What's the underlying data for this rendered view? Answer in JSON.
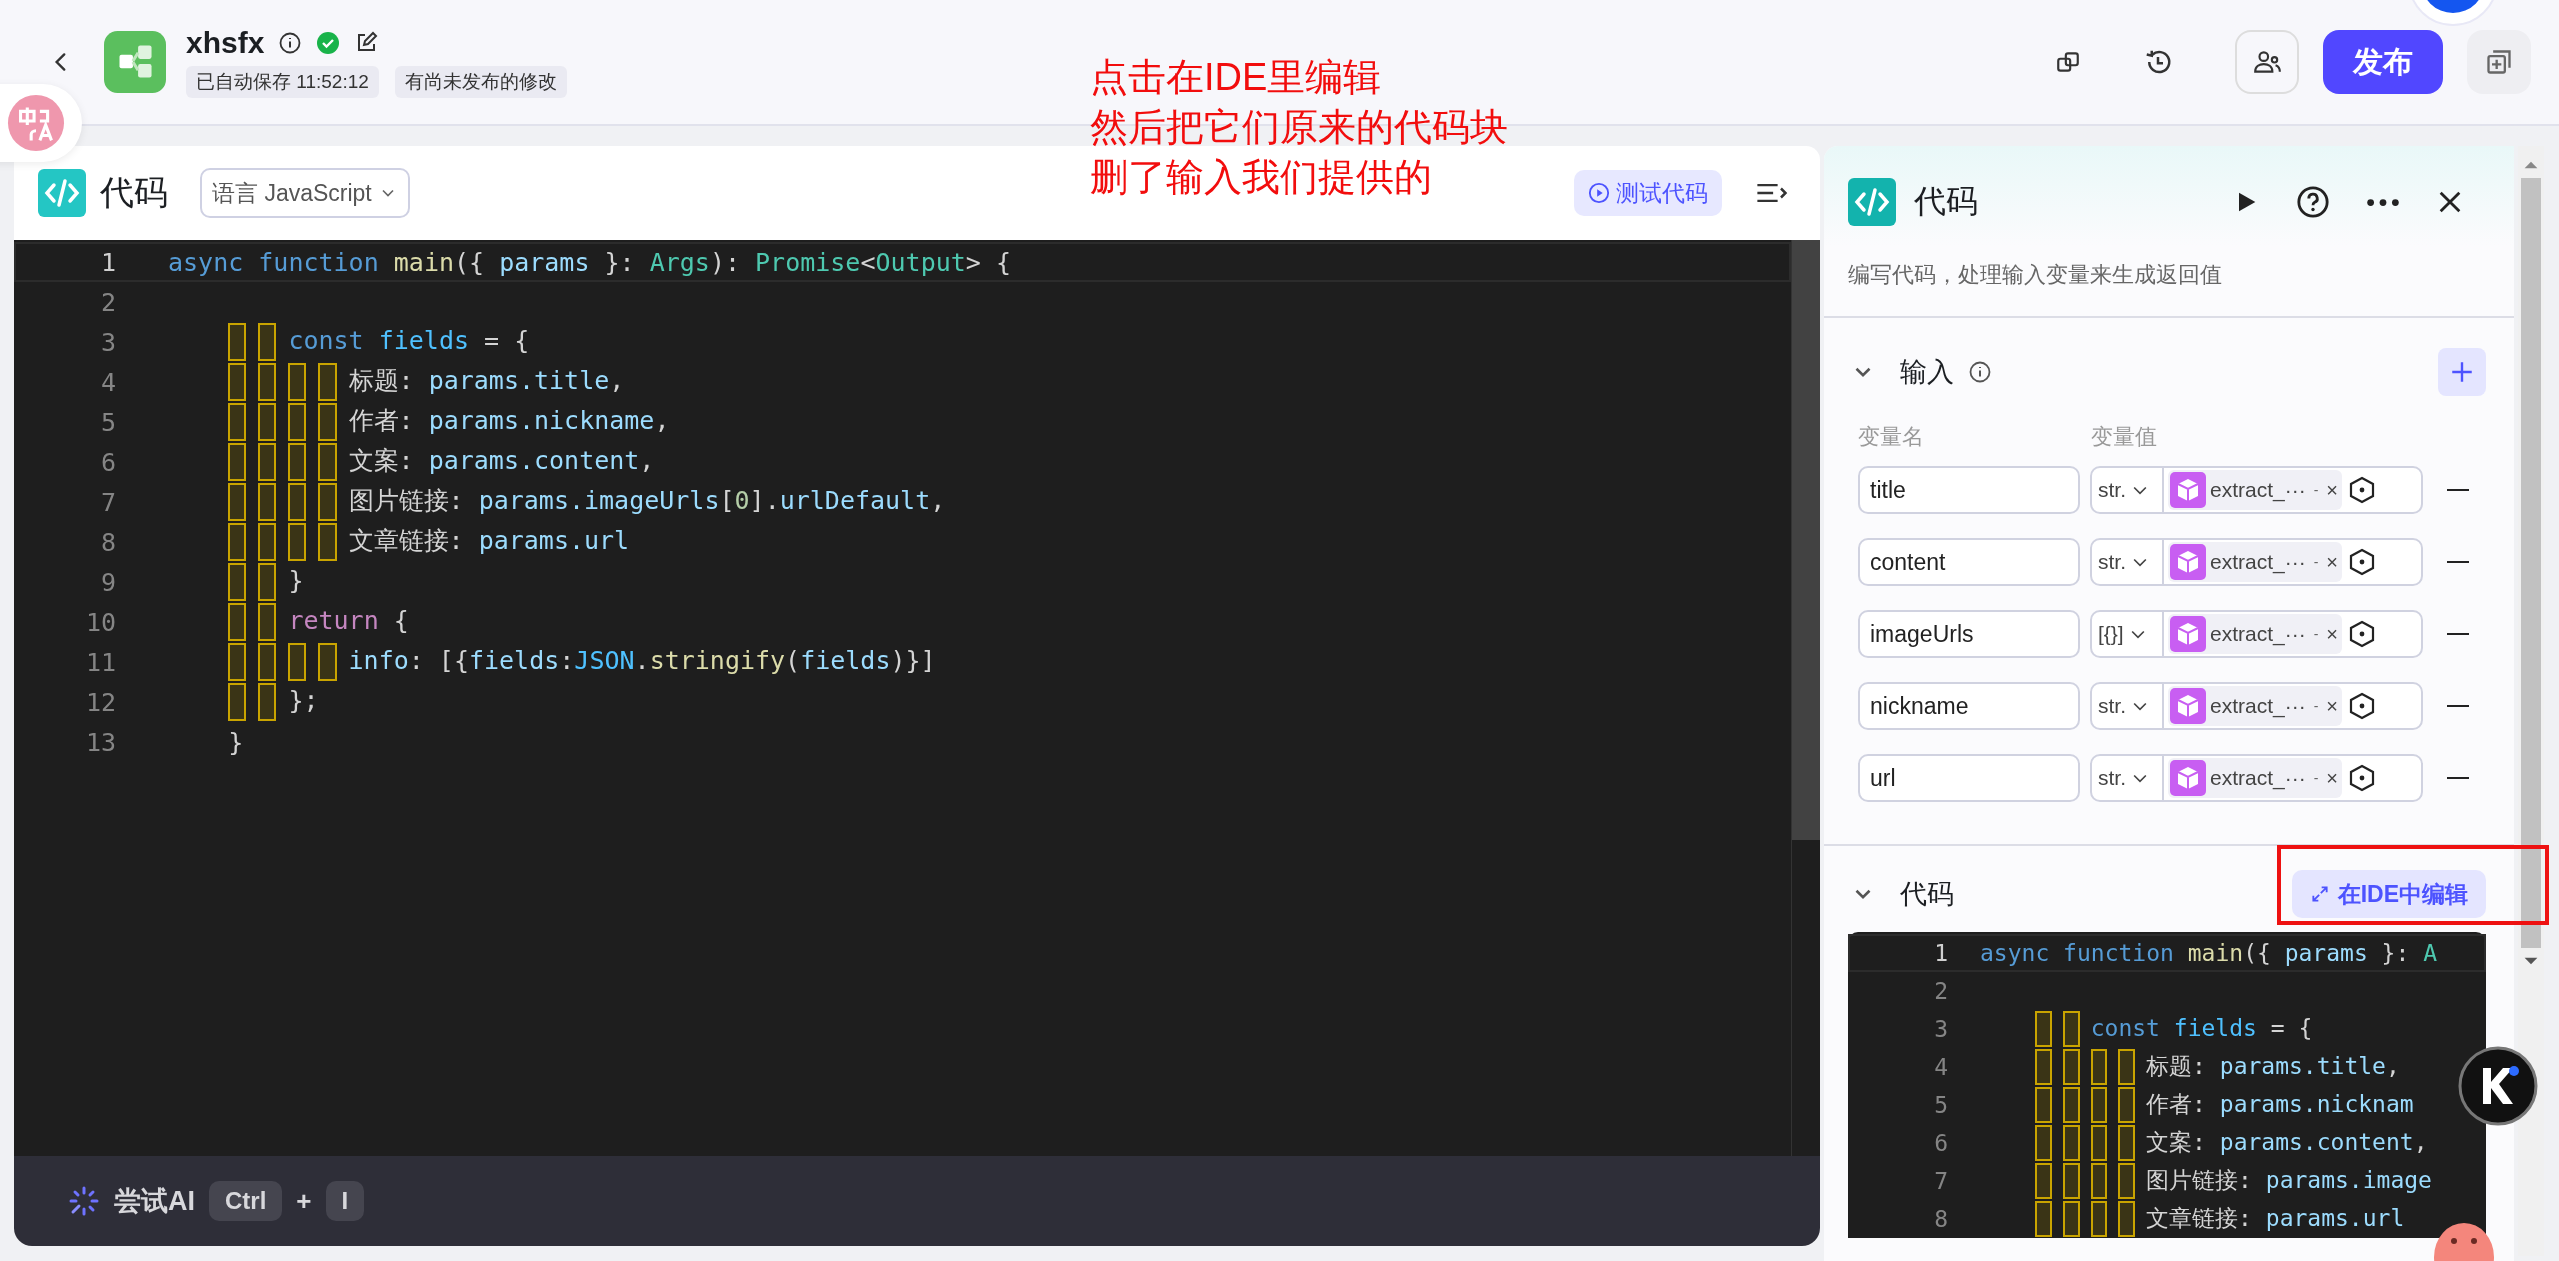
{
  "header": {
    "app_name": "xhsfx",
    "saved": true,
    "tags": [
      "已自动保存 11:52:12",
      "有尚未发布的修改"
    ],
    "publish_button": "发布"
  },
  "annotation": {
    "lines": [
      "点击在IDE里编辑",
      "然后把它们原来的代码块",
      "删了输入我们提供的"
    ]
  },
  "editor": {
    "title": "代码",
    "language_select": "语言 JavaScript",
    "test_button": "测试代码",
    "lines": [
      {
        "number": "1",
        "current": true,
        "tokens": [
          {
            "text": "async",
            "kind": "kw"
          },
          {
            "text": " function",
            "kind": "kw"
          },
          {
            "text": " main",
            "kind": "fn"
          },
          {
            "text": "({ ",
            "kind": "plain"
          },
          {
            "text": "params",
            "kind": "param"
          },
          {
            "text": " }: ",
            "kind": "plain"
          },
          {
            "text": "Args",
            "kind": "type"
          },
          {
            "text": "): ",
            "kind": "plain"
          },
          {
            "text": "Promise",
            "kind": "type"
          },
          {
            "text": "<",
            "kind": "plain"
          },
          {
            "text": "Output",
            "kind": "type"
          },
          {
            "text": "> {",
            "kind": "plain"
          }
        ]
      },
      {
        "number": "2",
        "current": false
      },
      {
        "number": "3",
        "current": false,
        "tokens": [
          {
            "text": "    　　const",
            "kind": "kw"
          },
          {
            "text": " fields",
            "kind": "const"
          },
          {
            "text": " = {",
            "kind": "plain"
          }
        ]
      },
      {
        "number": "4",
        "current": false,
        "tokens": [
          {
            "text": "    　　　　标题: ",
            "kind": "plain"
          },
          {
            "text": "params.title",
            "kind": "param"
          },
          {
            "text": ",",
            "kind": "plain"
          }
        ]
      },
      {
        "number": "5",
        "current": false,
        "tokens": [
          {
            "text": "    　　　　作者: ",
            "kind": "plain"
          },
          {
            "text": "params.nickname",
            "kind": "param"
          },
          {
            "text": ",",
            "kind": "plain"
          }
        ]
      },
      {
        "number": "6",
        "current": false,
        "tokens": [
          {
            "text": "    　　　　文案: ",
            "kind": "plain"
          },
          {
            "text": "params.content",
            "kind": "param"
          },
          {
            "text": ",",
            "kind": "plain"
          }
        ]
      },
      {
        "number": "7",
        "current": false,
        "tokens": [
          {
            "text": "    　　　　图片链接: ",
            "kind": "plain"
          },
          {
            "text": "params.imageUrls",
            "kind": "param"
          },
          {
            "text": "[",
            "kind": "plain"
          },
          {
            "text": "0",
            "kind": "num"
          },
          {
            "text": "].",
            "kind": "plain"
          },
          {
            "text": "urlDefault",
            "kind": "param"
          },
          {
            "text": ",",
            "kind": "plain"
          }
        ]
      },
      {
        "number": "8",
        "current": false,
        "tokens": [
          {
            "text": "    　　　　文章链接: ",
            "kind": "plain"
          },
          {
            "text": "params.url",
            "kind": "param"
          }
        ]
      },
      {
        "number": "9",
        "current": false,
        "tokens": [
          {
            "text": "    　　}",
            "kind": "plain"
          }
        ]
      },
      {
        "number": "10",
        "current": false,
        "tokens": [
          {
            "text": "    　　return",
            "kind": "ctrl"
          },
          {
            "text": " {",
            "kind": "plain"
          }
        ]
      },
      {
        "number": "11",
        "current": false,
        "tokens": [
          {
            "text": "    　　　　info",
            "kind": "param"
          },
          {
            "text": ": [{",
            "kind": "plain"
          },
          {
            "text": "fields",
            "kind": "param"
          },
          {
            "text": ":",
            "kind": "plain"
          },
          {
            "text": "JSON",
            "kind": "const"
          },
          {
            "text": ".",
            "kind": "plain"
          },
          {
            "text": "stringify",
            "kind": "fn"
          },
          {
            "text": "(",
            "kind": "plain"
          },
          {
            "text": "fields",
            "kind": "param"
          },
          {
            "text": ")}]",
            "kind": "plain"
          }
        ]
      },
      {
        "number": "12",
        "current": false,
        "tokens": [
          {
            "text": "    　　};",
            "kind": "plain"
          }
        ]
      },
      {
        "number": "13",
        "current": false,
        "tokens": [
          {
            "text": "    }",
            "kind": "plain"
          }
        ]
      }
    ],
    "ai_bar": {
      "label": "尝试AI",
      "keys": [
        "Ctrl",
        "I"
      ],
      "plus": "+"
    }
  },
  "node_panel": {
    "title": "代码",
    "description": "编写代码，处理输入变量来生成返回值",
    "input_section": {
      "title": "输入",
      "expanded": true,
      "columns": [
        "变量名",
        "变量值"
      ],
      "rows": [
        {
          "name": "title",
          "type": "str.",
          "value": "extract_···",
          "separator": "-",
          "remove": "×"
        },
        {
          "name": "content",
          "type": "str.",
          "value": "extract_···",
          "separator": "-",
          "remove": "×"
        },
        {
          "name": "imageUrls",
          "type": "[{}]",
          "value": "extract_···",
          "separator": "-",
          "remove": "×"
        },
        {
          "name": "nickname",
          "type": "str.",
          "value": "extract_···",
          "separator": "-",
          "remove": "×"
        },
        {
          "name": "url",
          "type": "str.",
          "value": "extract_···",
          "separator": "-",
          "remove": "×"
        }
      ]
    },
    "code_section": {
      "title": "代码",
      "expanded": true,
      "ide_button": "在IDE中编辑",
      "lines": [
        {
          "number": "1",
          "current": true,
          "tokens": [
            {
              "text": "async",
              "kind": "kw"
            },
            {
              "text": " function",
              "kind": "kw"
            },
            {
              "text": " main",
              "kind": "fn"
            },
            {
              "text": "({ ",
              "kind": "plain"
            },
            {
              "text": "params",
              "kind": "param"
            },
            {
              "text": " }: ",
              "kind": "plain"
            },
            {
              "text": "A",
              "kind": "type"
            }
          ]
        },
        {
          "number": "2",
          "current": false
        },
        {
          "number": "3",
          "current": false,
          "tokens": [
            {
              "text": "    　　const",
              "kind": "kw"
            },
            {
              "text": " fields",
              "kind": "const"
            },
            {
              "text": " = {",
              "kind": "plain"
            }
          ]
        },
        {
          "number": "4",
          "current": false,
          "tokens": [
            {
              "text": "    　　　　标题: ",
              "kind": "plain"
            },
            {
              "text": "params.title",
              "kind": "param"
            },
            {
              "text": ",",
              "kind": "plain"
            }
          ]
        },
        {
          "number": "5",
          "current": false,
          "tokens": [
            {
              "text": "    　　　　作者: ",
              "kind": "plain"
            },
            {
              "text": "params.nicknam",
              "kind": "param"
            }
          ]
        },
        {
          "number": "6",
          "current": false,
          "tokens": [
            {
              "text": "    　　　　文案: ",
              "kind": "plain"
            },
            {
              "text": "params.content",
              "kind": "param"
            },
            {
              "text": ",",
              "kind": "plain"
            }
          ]
        },
        {
          "number": "7",
          "current": false,
          "tokens": [
            {
              "text": "    　　　　图片链接: ",
              "kind": "plain"
            },
            {
              "text": "params.image",
              "kind": "param"
            }
          ]
        },
        {
          "number": "8",
          "current": false,
          "tokens": [
            {
              "text": "    　　　　文章链接: ",
              "kind": "plain"
            },
            {
              "text": "params.url",
              "kind": "param"
            }
          ]
        }
      ]
    }
  }
}
